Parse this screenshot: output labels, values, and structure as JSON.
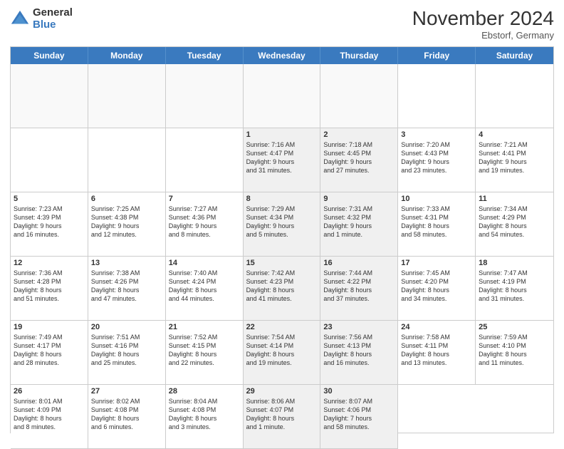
{
  "header": {
    "logo": {
      "general": "General",
      "blue": "Blue"
    },
    "title": "November 2024",
    "location": "Ebstorf, Germany"
  },
  "days": {
    "headers": [
      "Sunday",
      "Monday",
      "Tuesday",
      "Wednesday",
      "Thursday",
      "Friday",
      "Saturday"
    ]
  },
  "cells": [
    {
      "day": "",
      "info": "",
      "empty": true
    },
    {
      "day": "",
      "info": "",
      "empty": true
    },
    {
      "day": "",
      "info": "",
      "empty": true
    },
    {
      "day": "",
      "info": "",
      "empty": true
    },
    {
      "day": "",
      "info": "",
      "empty": true
    },
    {
      "day": "1",
      "info": "Sunrise: 7:16 AM\nSunset: 4:47 PM\nDaylight: 9 hours\nand 31 minutes.",
      "shaded": true
    },
    {
      "day": "2",
      "info": "Sunrise: 7:18 AM\nSunset: 4:45 PM\nDaylight: 9 hours\nand 27 minutes.",
      "shaded": true
    },
    {
      "day": "3",
      "info": "Sunrise: 7:20 AM\nSunset: 4:43 PM\nDaylight: 9 hours\nand 23 minutes."
    },
    {
      "day": "4",
      "info": "Sunrise: 7:21 AM\nSunset: 4:41 PM\nDaylight: 9 hours\nand 19 minutes."
    },
    {
      "day": "5",
      "info": "Sunrise: 7:23 AM\nSunset: 4:39 PM\nDaylight: 9 hours\nand 16 minutes."
    },
    {
      "day": "6",
      "info": "Sunrise: 7:25 AM\nSunset: 4:38 PM\nDaylight: 9 hours\nand 12 minutes."
    },
    {
      "day": "7",
      "info": "Sunrise: 7:27 AM\nSunset: 4:36 PM\nDaylight: 9 hours\nand 8 minutes."
    },
    {
      "day": "8",
      "info": "Sunrise: 7:29 AM\nSunset: 4:34 PM\nDaylight: 9 hours\nand 5 minutes.",
      "shaded": true
    },
    {
      "day": "9",
      "info": "Sunrise: 7:31 AM\nSunset: 4:32 PM\nDaylight: 9 hours\nand 1 minute.",
      "shaded": true
    },
    {
      "day": "10",
      "info": "Sunrise: 7:33 AM\nSunset: 4:31 PM\nDaylight: 8 hours\nand 58 minutes."
    },
    {
      "day": "11",
      "info": "Sunrise: 7:34 AM\nSunset: 4:29 PM\nDaylight: 8 hours\nand 54 minutes."
    },
    {
      "day": "12",
      "info": "Sunrise: 7:36 AM\nSunset: 4:28 PM\nDaylight: 8 hours\nand 51 minutes."
    },
    {
      "day": "13",
      "info": "Sunrise: 7:38 AM\nSunset: 4:26 PM\nDaylight: 8 hours\nand 47 minutes."
    },
    {
      "day": "14",
      "info": "Sunrise: 7:40 AM\nSunset: 4:24 PM\nDaylight: 8 hours\nand 44 minutes."
    },
    {
      "day": "15",
      "info": "Sunrise: 7:42 AM\nSunset: 4:23 PM\nDaylight: 8 hours\nand 41 minutes.",
      "shaded": true
    },
    {
      "day": "16",
      "info": "Sunrise: 7:44 AM\nSunset: 4:22 PM\nDaylight: 8 hours\nand 37 minutes.",
      "shaded": true
    },
    {
      "day": "17",
      "info": "Sunrise: 7:45 AM\nSunset: 4:20 PM\nDaylight: 8 hours\nand 34 minutes."
    },
    {
      "day": "18",
      "info": "Sunrise: 7:47 AM\nSunset: 4:19 PM\nDaylight: 8 hours\nand 31 minutes."
    },
    {
      "day": "19",
      "info": "Sunrise: 7:49 AM\nSunset: 4:17 PM\nDaylight: 8 hours\nand 28 minutes."
    },
    {
      "day": "20",
      "info": "Sunrise: 7:51 AM\nSunset: 4:16 PM\nDaylight: 8 hours\nand 25 minutes."
    },
    {
      "day": "21",
      "info": "Sunrise: 7:52 AM\nSunset: 4:15 PM\nDaylight: 8 hours\nand 22 minutes."
    },
    {
      "day": "22",
      "info": "Sunrise: 7:54 AM\nSunset: 4:14 PM\nDaylight: 8 hours\nand 19 minutes.",
      "shaded": true
    },
    {
      "day": "23",
      "info": "Sunrise: 7:56 AM\nSunset: 4:13 PM\nDaylight: 8 hours\nand 16 minutes.",
      "shaded": true
    },
    {
      "day": "24",
      "info": "Sunrise: 7:58 AM\nSunset: 4:11 PM\nDaylight: 8 hours\nand 13 minutes."
    },
    {
      "day": "25",
      "info": "Sunrise: 7:59 AM\nSunset: 4:10 PM\nDaylight: 8 hours\nand 11 minutes."
    },
    {
      "day": "26",
      "info": "Sunrise: 8:01 AM\nSunset: 4:09 PM\nDaylight: 8 hours\nand 8 minutes."
    },
    {
      "day": "27",
      "info": "Sunrise: 8:02 AM\nSunset: 4:08 PM\nDaylight: 8 hours\nand 6 minutes."
    },
    {
      "day": "28",
      "info": "Sunrise: 8:04 AM\nSunset: 4:08 PM\nDaylight: 8 hours\nand 3 minutes."
    },
    {
      "day": "29",
      "info": "Sunrise: 8:06 AM\nSunset: 4:07 PM\nDaylight: 8 hours\nand 1 minute.",
      "shaded": true
    },
    {
      "day": "30",
      "info": "Sunrise: 8:07 AM\nSunset: 4:06 PM\nDaylight: 7 hours\nand 58 minutes.",
      "shaded": true
    }
  ]
}
